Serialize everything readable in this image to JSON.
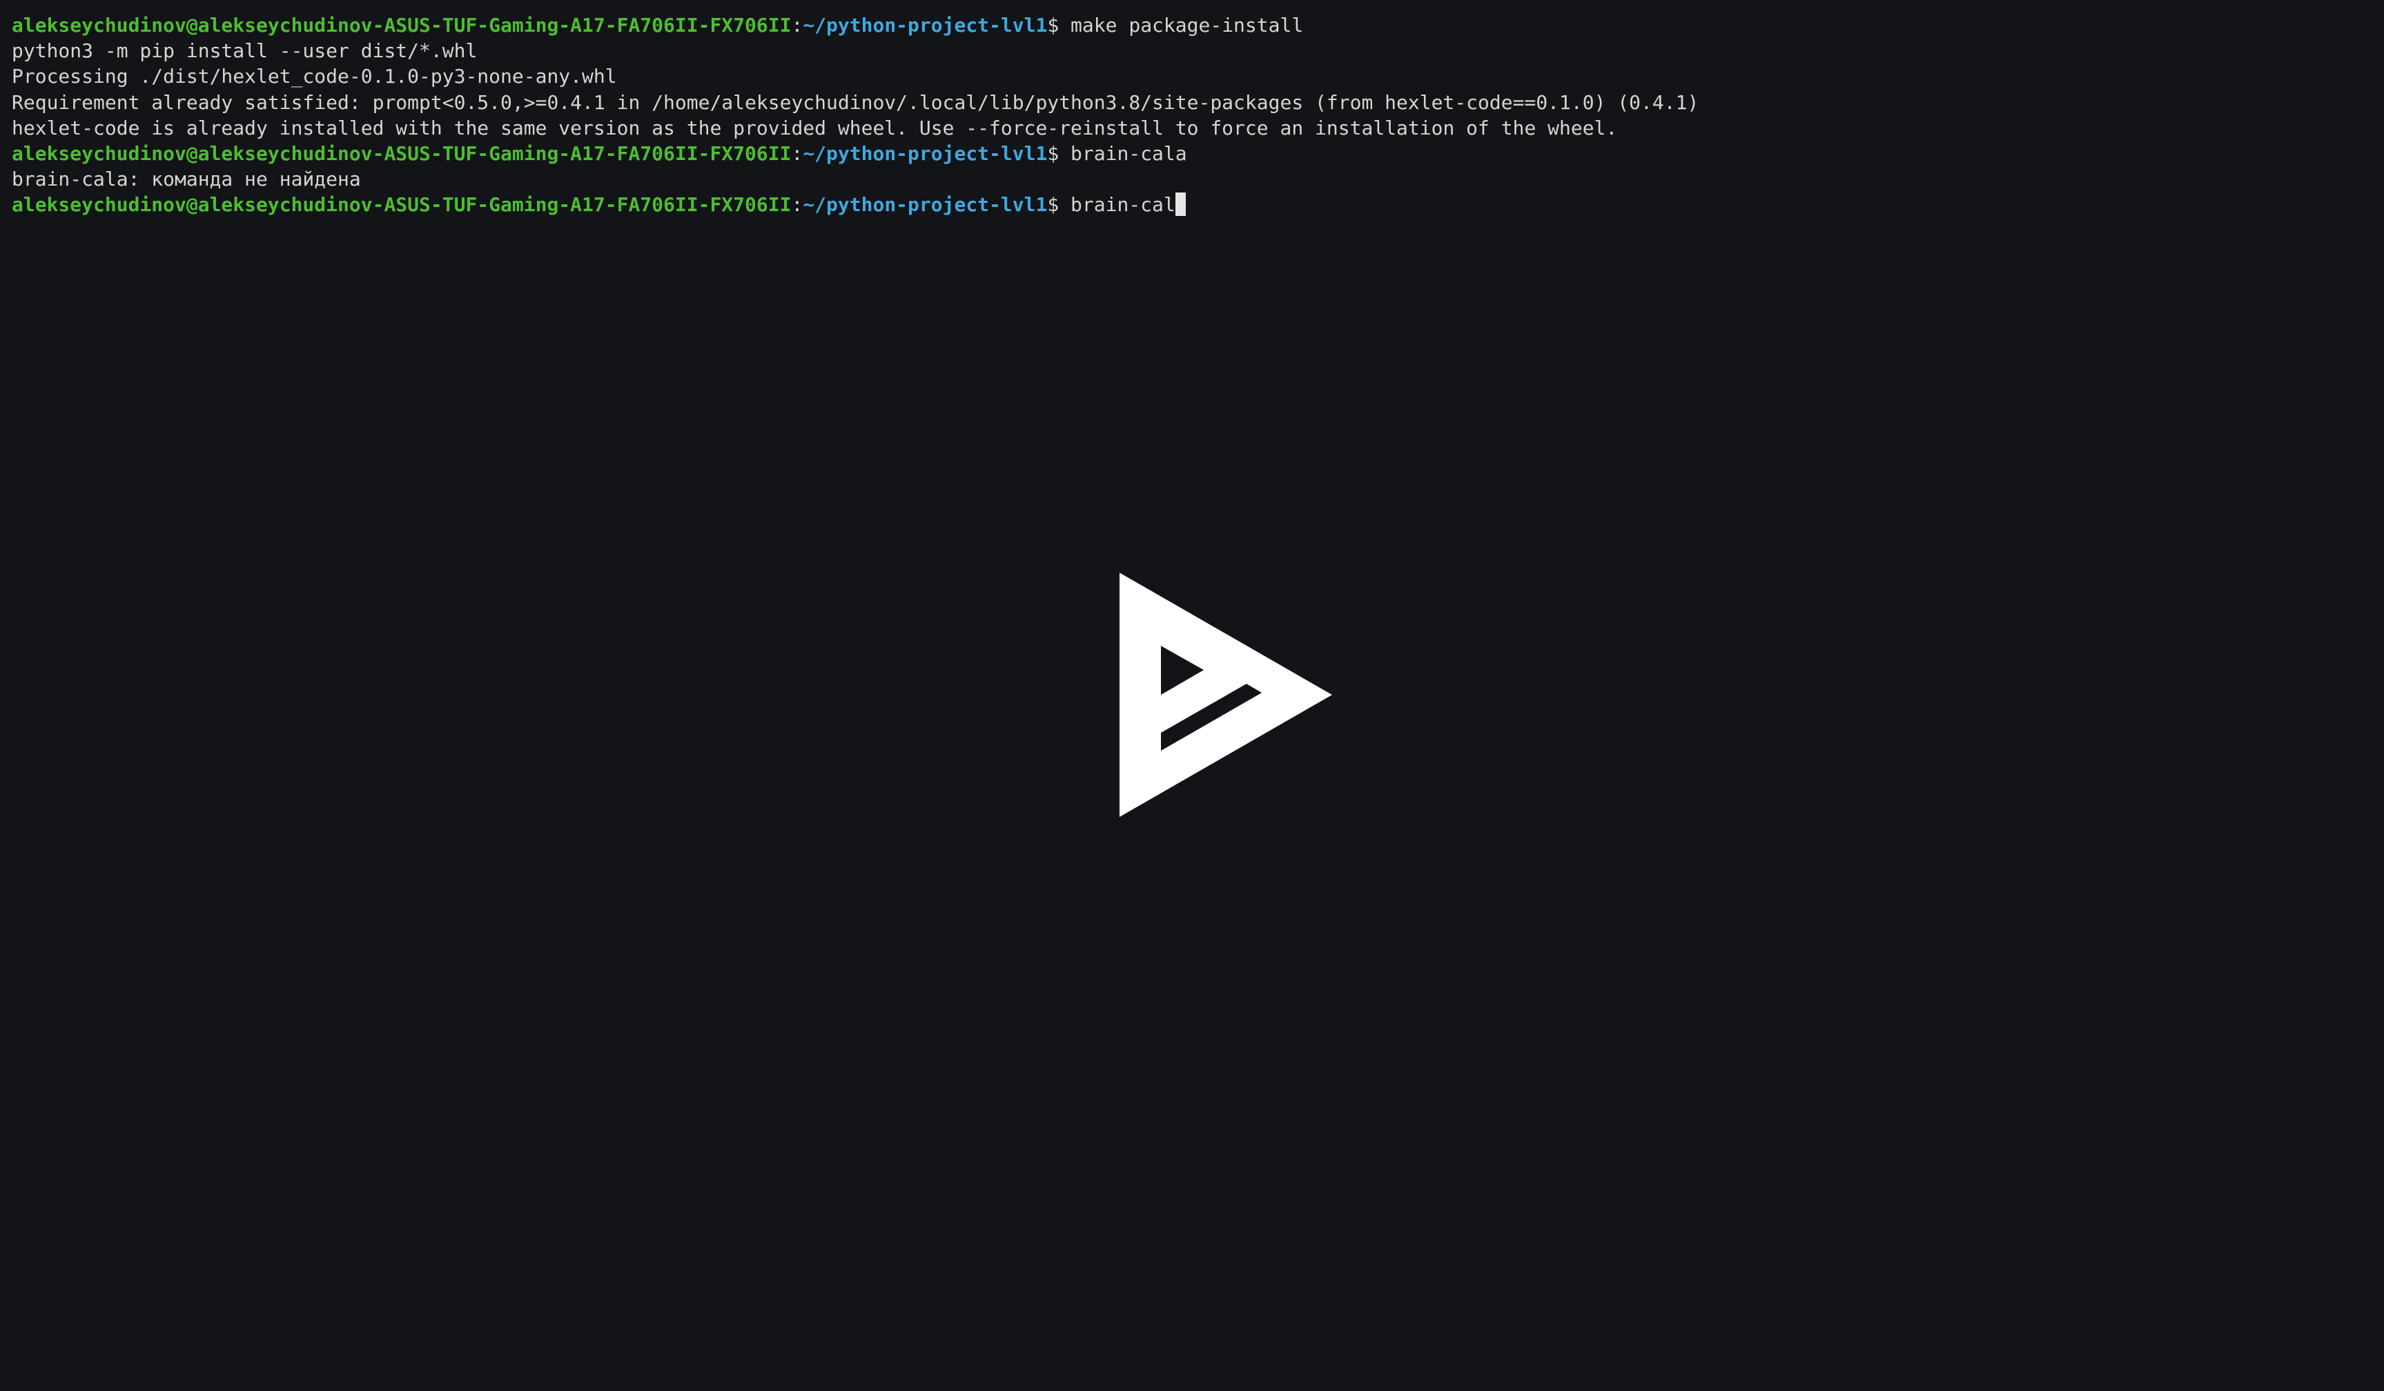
{
  "prompt": {
    "user_host": "alekseychudinov@alekseychudinov-ASUS-TUF-Gaming-A17-FA706II-FX706II",
    "separator": ":",
    "path": "~/python-project-lvl1",
    "symbol": "$"
  },
  "commands": [
    "make package-install",
    "brain-cala",
    "brain-cal"
  ],
  "outputs": {
    "install": [
      "python3 -m pip install --user dist/*.whl",
      "Processing ./dist/hexlet_code-0.1.0-py3-none-any.whl",
      "Requirement already satisfied: prompt<0.5.0,>=0.4.1 in /home/alekseychudinov/.local/lib/python3.8/site-packages (from hexlet-code==0.1.0) (0.4.1)",
      "hexlet-code is already installed with the same version as the provided wheel. Use --force-reinstall to force an installation of the wheel."
    ],
    "not_found": "brain-cala: команда не найдена"
  },
  "colors": {
    "background": "#121417",
    "user_host": "#4cbf2f",
    "path": "#3ea8e0",
    "text": "#d3d7cf",
    "overlay_logo": "#ffffff"
  },
  "icons": {
    "overlay": "play-logo-icon"
  }
}
